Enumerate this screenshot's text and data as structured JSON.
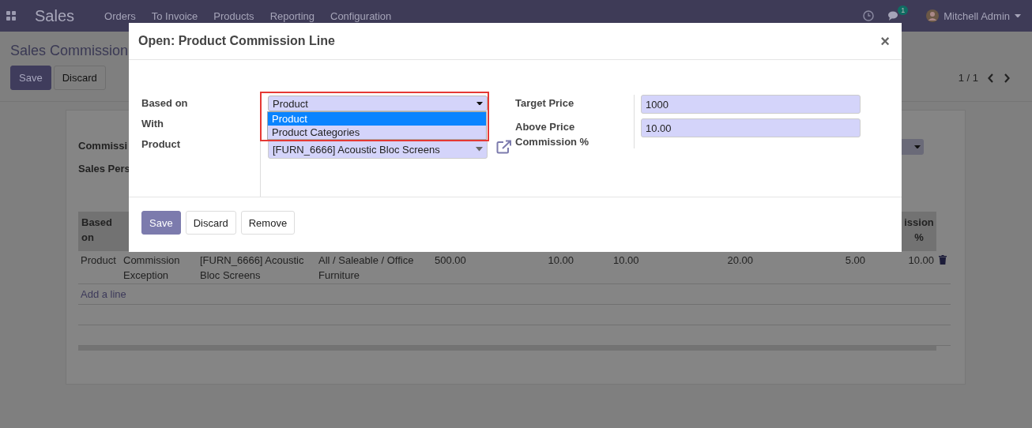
{
  "navbar": {
    "app": "Sales",
    "menu": [
      "Orders",
      "To Invoice",
      "Products",
      "Reporting",
      "Configuration"
    ],
    "chat_badge": "1",
    "user": "Mitchell Admin"
  },
  "control_panel": {
    "title": "Sales Commission",
    "buttons": [
      {
        "label": "Save",
        "primary": true
      },
      {
        "label": "Discard",
        "primary": false
      }
    ],
    "pager": "1 / 1"
  },
  "sheet": {
    "labels": [
      "Commissi",
      "Sales Pers"
    ],
    "table": {
      "header": {
        "column_1": "Based on",
        "column_10": "ission %"
      },
      "rows": [
        {
          "cells": [
            "Product",
            "Commission Exception",
            "[FURN_6666] Acoustic Bloc Screens",
            "All / Saleable / Office Furniture",
            "500.00",
            "10.00",
            "10.00",
            "20.00",
            "5.00",
            "10.00"
          ]
        }
      ],
      "add_line": "Add a line"
    }
  },
  "dialog": {
    "title": "Open: Product Commission Line",
    "close": "×",
    "left_fields": [
      {
        "label": "Based on",
        "kind": "select",
        "value": "Product"
      },
      {
        "label": "With",
        "kind": "hidden"
      },
      {
        "label": "Product",
        "kind": "many2one",
        "value": "[FURN_6666] Acoustic Bloc Screens"
      }
    ],
    "dropdown": [
      {
        "label": "Product",
        "selected": true
      },
      {
        "label": "Product Categories",
        "selected": false
      }
    ],
    "right_fields": [
      {
        "label": "Target Price",
        "value": "1000"
      },
      {
        "label": "Above Price Commission %",
        "value": "10.00"
      }
    ],
    "buttons": [
      {
        "label": "Save",
        "primary": true
      },
      {
        "label": "Discard",
        "primary": false
      },
      {
        "label": "Remove",
        "primary": false
      }
    ]
  }
}
